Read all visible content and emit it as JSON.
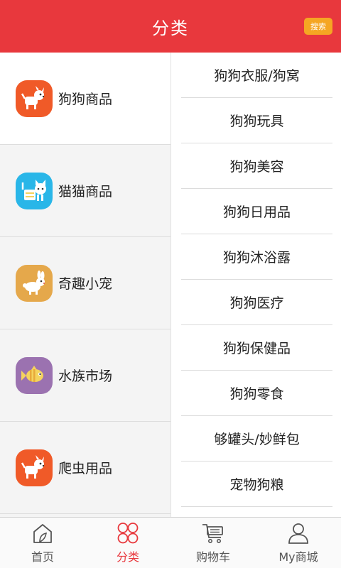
{
  "header": {
    "title": "分类",
    "search_label": "搜索"
  },
  "categories": [
    {
      "label": "狗狗商品",
      "icon": "dog-icon",
      "color": "#f05a28",
      "active": true
    },
    {
      "label": "猫猫商品",
      "icon": "cat-icon",
      "color": "#29b6e8",
      "active": false
    },
    {
      "label": "奇趣小宠",
      "icon": "rabbit-icon",
      "color": "#e5a84b",
      "active": false
    },
    {
      "label": "水族市场",
      "icon": "fish-icon",
      "color": "#9b72b0",
      "active": false
    },
    {
      "label": "爬虫用品",
      "icon": "dog-icon",
      "color": "#f05a28",
      "active": false
    }
  ],
  "subcategories": [
    "狗狗衣服/狗窝",
    "狗狗玩具",
    "狗狗美容",
    "狗狗日用品",
    "狗狗沐浴露",
    "狗狗医疗",
    "狗狗保健品",
    "狗狗零食",
    "够罐头/妙鲜包",
    "宠物狗粮"
  ],
  "tabbar": [
    {
      "label": "首页",
      "icon": "home-icon"
    },
    {
      "label": "分类",
      "icon": "category-icon",
      "active": true
    },
    {
      "label": "购物车",
      "icon": "cart-icon"
    },
    {
      "label": "My商城",
      "icon": "user-icon"
    }
  ],
  "colors": {
    "brand": "#e8383d",
    "search": "#f5a623"
  }
}
